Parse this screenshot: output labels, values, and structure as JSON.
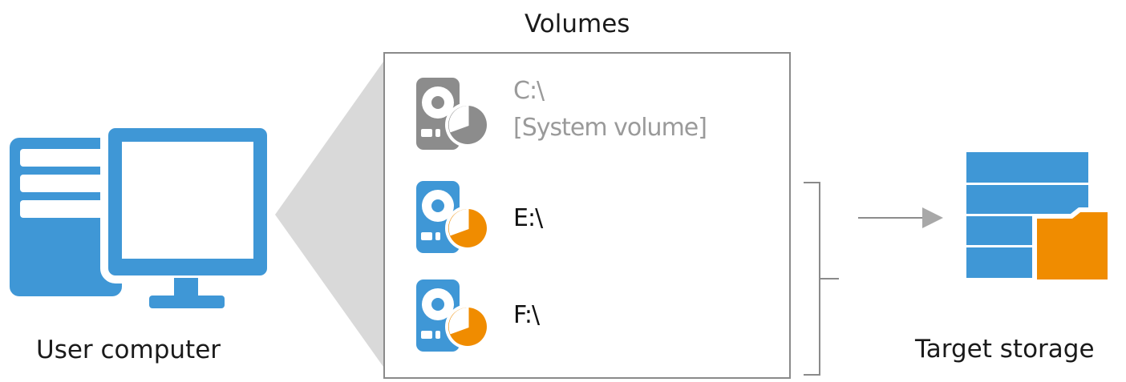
{
  "diagram": {
    "title": "Volumes",
    "source_label": "User computer",
    "target_label": "Target storage",
    "volumes": [
      {
        "name": "C:\\",
        "note": "[System volume]",
        "selected": false
      },
      {
        "name": "E:\\",
        "note": "",
        "selected": true
      },
      {
        "name": "F:\\",
        "note": "",
        "selected": true
      }
    ]
  },
  "colors": {
    "blue": "#3f97d6",
    "orange": "#f08c00",
    "gray": "#8c8c8c",
    "light_gray": "#d9d9d9",
    "box_border": "#8a8a8a"
  },
  "icons": {
    "computer": "computer-icon",
    "volume": "hard-disk-icon",
    "storage": "storage-folder-icon"
  }
}
